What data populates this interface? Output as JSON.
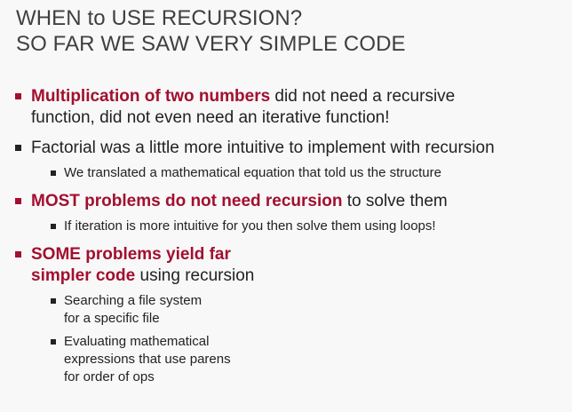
{
  "slide": {
    "title_lines": [
      "WHEN to USE RECURSION?",
      "SO FAR WE SAW VERY SIMPLE CODE"
    ],
    "bullets": [
      {
        "highlight": "Multiplication of two numbers",
        "rest_line1": " did not need a recursive",
        "rest_line2": "function, did not even need an iterative function!"
      },
      {
        "text": "Factorial was a little more intuitive to implement with recursion",
        "sub": "We translated a mathematical equation that told us the structure"
      },
      {
        "highlight": "MOST problems do not need recursion",
        "rest": " to solve them",
        "sub": "If iteration is more intuitive for you then solve them using loops!"
      },
      {
        "highlight_line1": "SOME problems yield far",
        "highlight_line2": "simpler code",
        "rest": " using recursion",
        "subs": [
          [
            "Searching a file system",
            "for a specific file"
          ],
          [
            "Evaluating mathematical",
            "expressions that use parens",
            "for order of ops"
          ]
        ]
      }
    ]
  },
  "colors": {
    "accent": "#a20f2f",
    "text": "#222222",
    "title": "#3f3f3f",
    "background": "#f8f8f8"
  }
}
